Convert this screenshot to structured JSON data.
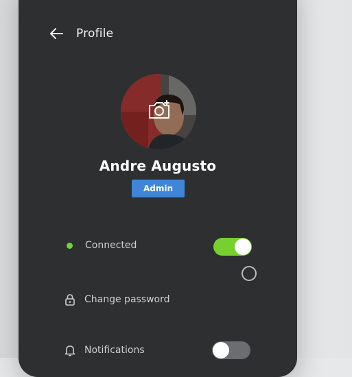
{
  "header": {
    "title": "Profile",
    "back_icon": "arrow-left-icon"
  },
  "profile": {
    "name": "Andre Augusto",
    "role_badge": "Admin",
    "change_photo_icon": "camera-plus-icon"
  },
  "settings": {
    "connected": {
      "label": "Connected",
      "status_color": "#6fd33a",
      "toggle_on": true
    },
    "change_password": {
      "label": "Change password",
      "icon": "lock-icon"
    },
    "notifications": {
      "label": "Notifications",
      "icon": "bell-icon",
      "toggle_on": false
    }
  },
  "colors": {
    "panel": "#2e2f31",
    "accent_blue": "#3f86d9",
    "toggle_green": "#76d130"
  }
}
